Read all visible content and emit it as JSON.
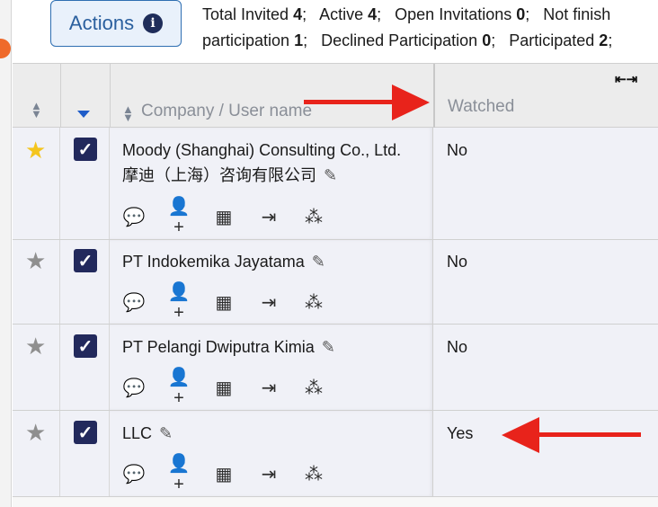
{
  "actions": {
    "label": "Actions",
    "icon": "info-icon"
  },
  "stats": {
    "line1": [
      {
        "label": "Total Invited ",
        "value": "4"
      },
      {
        "label": "Active ",
        "value": "4"
      },
      {
        "label": "Open Invitations ",
        "value": "0"
      },
      {
        "label": "Not finish",
        "value": ""
      }
    ],
    "line2": [
      {
        "label": "participation ",
        "value": "1"
      },
      {
        "label": "Declined Participation ",
        "value": "0"
      },
      {
        "label": "Participated ",
        "value": "2"
      }
    ]
  },
  "table": {
    "headers": {
      "company": "Company / User name",
      "watched": "Watched",
      "expand_icon": "⇤⇥"
    },
    "rows": [
      {
        "starred": true,
        "checked": true,
        "company": "Moody (Shanghai) Consulting Co., Ltd. 摩迪（上海）咨询有限公司",
        "watched": "No"
      },
      {
        "starred": false,
        "checked": true,
        "company": "PT Indokemika Jayatama",
        "watched": "No"
      },
      {
        "starred": false,
        "checked": true,
        "company": "PT Pelangi Dwiputra Kimia",
        "watched": "No"
      },
      {
        "starred": false,
        "checked": true,
        "company": "LLC",
        "watched": "Yes"
      }
    ],
    "row_icons": [
      "chat-icon",
      "add-user-icon",
      "buildings-icon",
      "login-icon",
      "group-icon"
    ]
  },
  "colors": {
    "accent": "#2a5f9e",
    "checkbox": "#22295c",
    "star_active": "#f4c51e",
    "star_inactive": "#8f8f8f",
    "arrow": "#e8231b"
  }
}
